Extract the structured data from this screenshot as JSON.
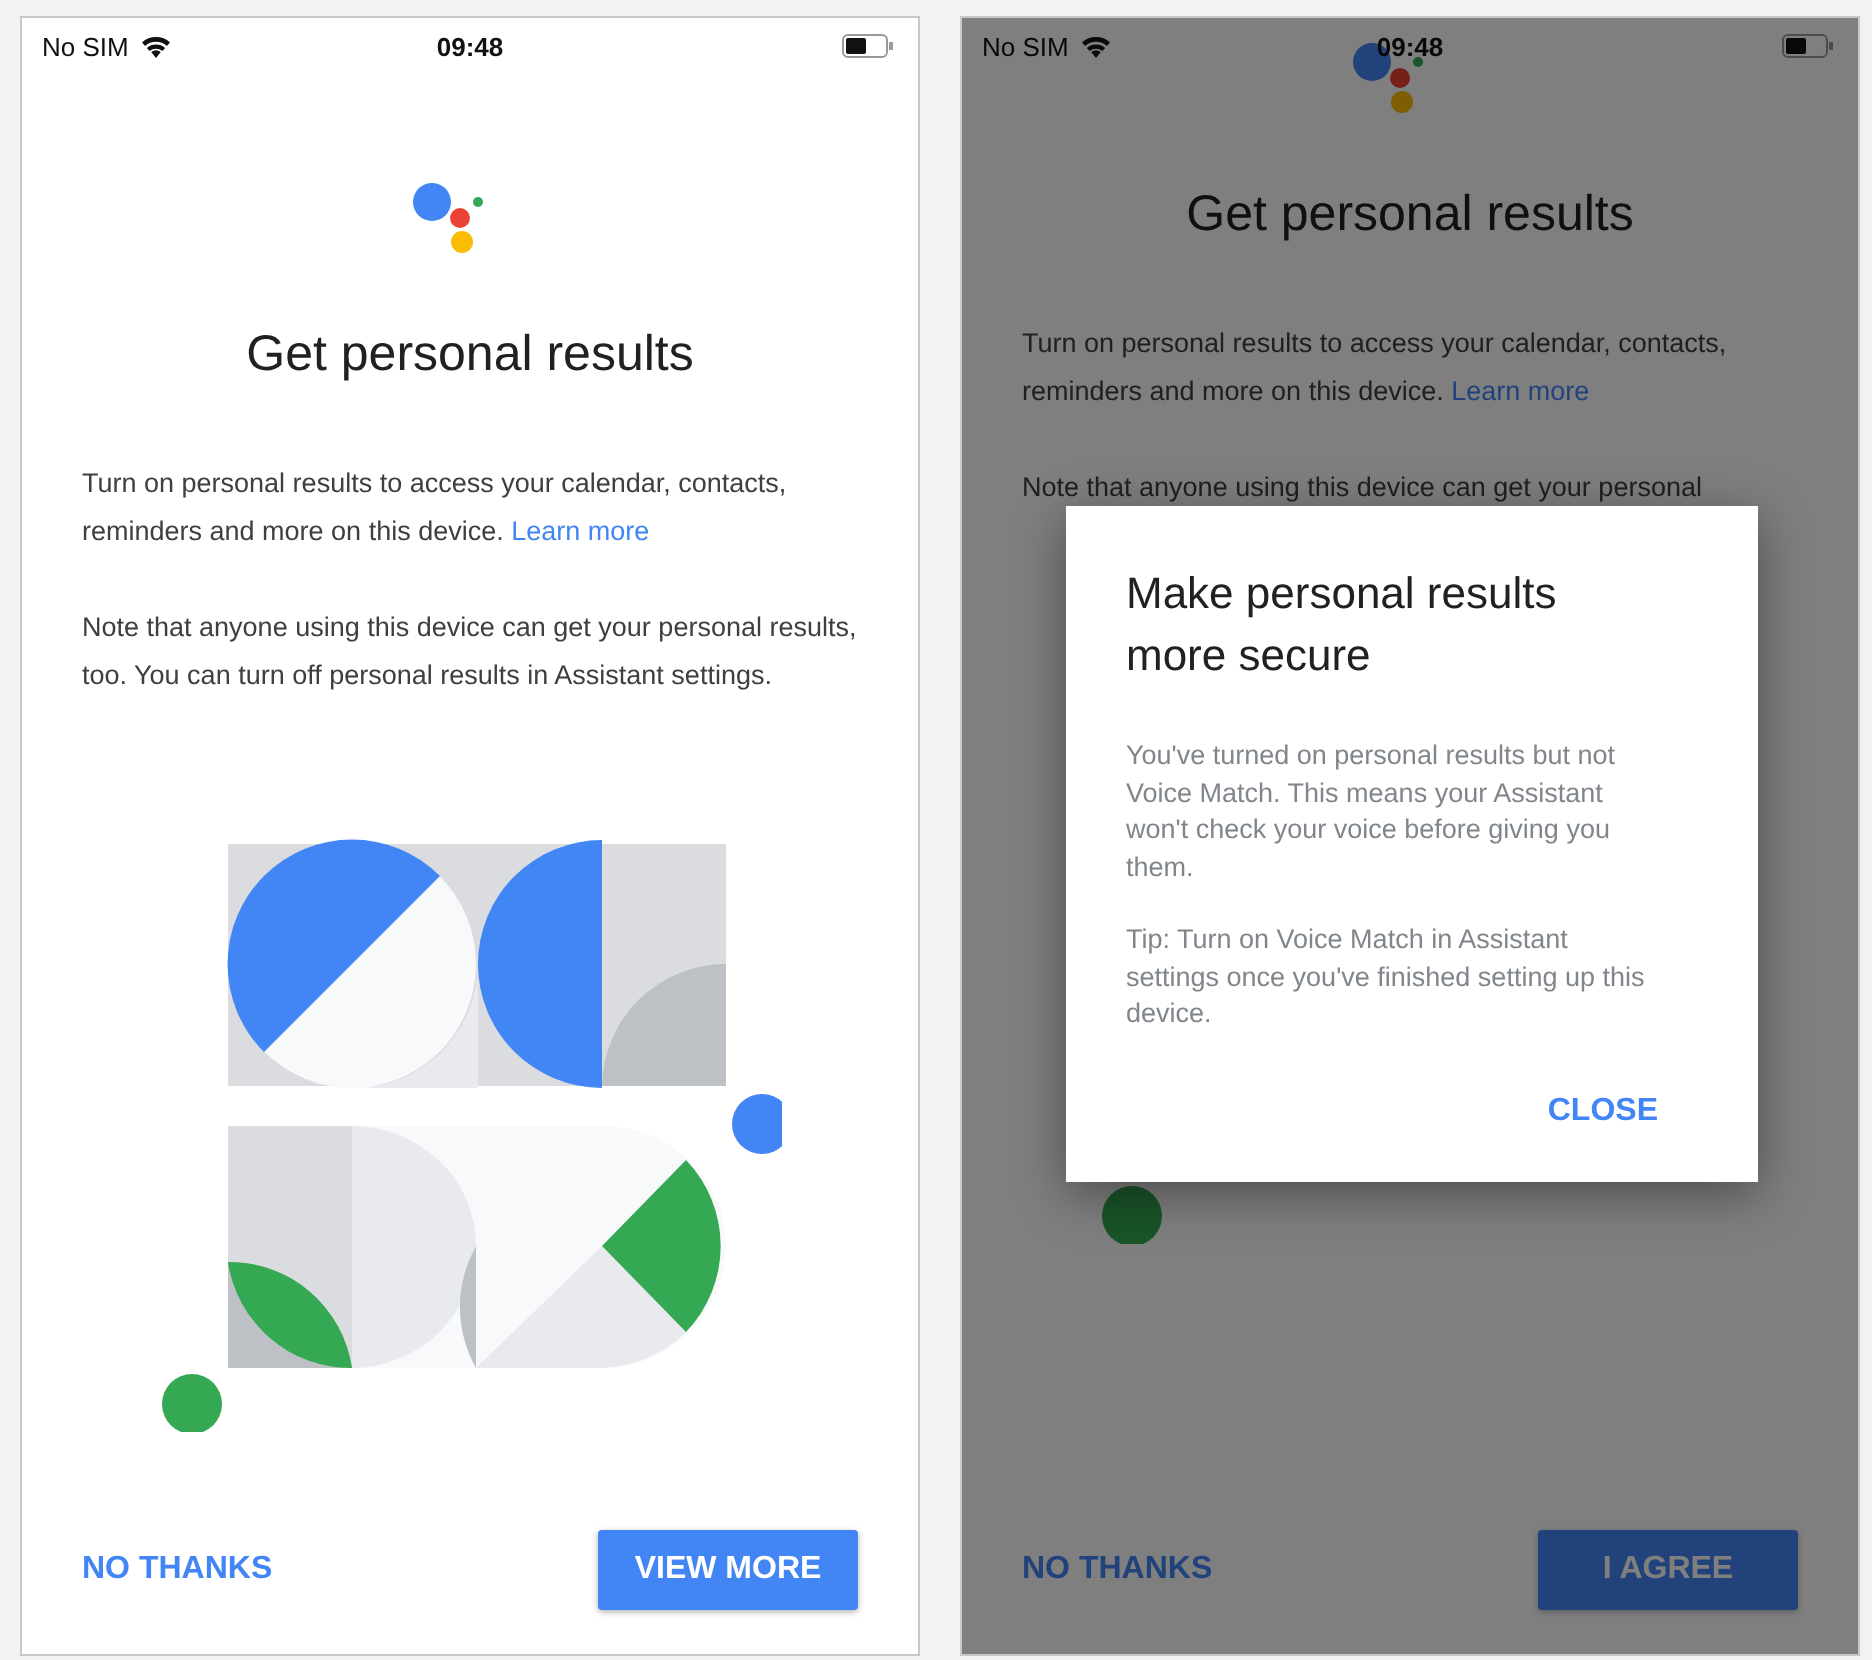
{
  "screens": [
    {
      "status_bar": {
        "carrier": "No SIM",
        "time": "09:48"
      },
      "title": "Get personal results",
      "intro": "Turn on personal results to access your calendar, contacts, reminders and more on this device.",
      "link": "Learn more",
      "note": "Note that anyone using this device can get your personal results, too. You can turn off personal results in Assistant settings.",
      "secondary_button": "NO THANKS",
      "primary_button": "VIEW MORE"
    },
    {
      "status_bar": {
        "carrier": "No SIM",
        "time": "09:48"
      },
      "title": "Get personal results",
      "intro": "Turn on personal results to access your calendar, contacts, reminders and more on this device.",
      "link": "Learn more",
      "note": "Note that anyone using this device can get your personal",
      "secondary_button": "NO THANKS",
      "primary_button": "I AGREE",
      "dialog": {
        "title": "Make personal results more secure",
        "body": "You've turned on personal results but not Voice Match. This means your Assistant won't check your voice before giving you them.",
        "tip": "Tip: Turn on Voice Match in Assistant settings once you've finished setting up this device.",
        "button": "CLOSE"
      }
    }
  ]
}
